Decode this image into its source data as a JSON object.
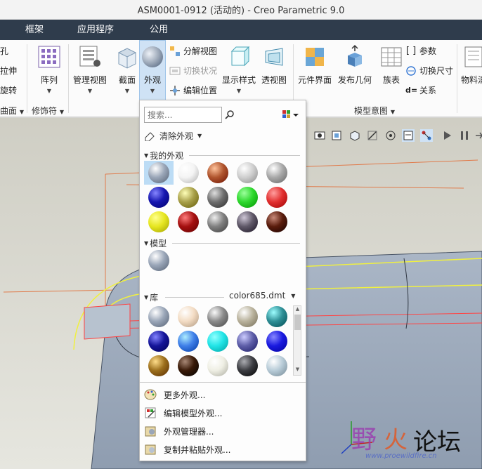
{
  "window": {
    "title": "ASM0001-0912 (活动的) - Creo Parametric 9.0"
  },
  "tabs": [
    "框架",
    "应用程序",
    "公用"
  ],
  "ribbon": {
    "left_partial": [
      "孔",
      "拉伸",
      "旋转",
      "曲面"
    ],
    "pattern": "阵列",
    "modifier_group": "修饰符",
    "manage_view": "管理视图",
    "section": "截面",
    "appearance": "外观",
    "explode_view": "分解视图",
    "toggle_state": "切换状况",
    "edit_position": "编辑位置",
    "display_style": "显示样式",
    "perspective": "透视图",
    "component_interface": "元件界面",
    "publish_geometry": "发布几何",
    "family_table": "族表",
    "parameters": "参数",
    "switch_dimensions": "切换尺寸",
    "relations": "关系",
    "model_intent_group": "模型意图",
    "material_partial": "物料清"
  },
  "panel": {
    "search_placeholder": "搜索...",
    "clear_appearance": "清除外观",
    "my_appearances": "我的外观",
    "model": "模型",
    "library": "库",
    "library_file": "color685.dmt",
    "more_appearances": "更多外观...",
    "edit_model_appearance": "编辑模型外观...",
    "appearance_manager": "外观管理器...",
    "copy_paste": "复制并粘贴外观..."
  },
  "swatches": {
    "my_appearances": [
      "#9aa6b8",
      "#f4f4f4",
      "#b0552e",
      "#cfcfcf",
      "#a9a9a9",
      "#1717b0",
      "#a8a04a",
      "#6f6f6f",
      "#2ed82e",
      "#e23030",
      "#e6e620",
      "#a51010",
      "#808080",
      "#5f5868",
      "#5a1c0c"
    ],
    "model": [
      "#9aa6b8"
    ],
    "library": [
      "#9aa6b8",
      "#f3dcc4",
      "#8b8b8b",
      "#b9b29c",
      "#2f8f96",
      "#151599",
      "#3f7fe8",
      "#21e4e6",
      "#5e5ea8",
      "#1a1ae0",
      "#9c6f1c",
      "#3a1a08",
      "#efefe4",
      "#3c3d42",
      "#b8ccd8"
    ]
  },
  "watermark": {
    "text": "论坛",
    "url": "www.proewildfire.cn"
  }
}
